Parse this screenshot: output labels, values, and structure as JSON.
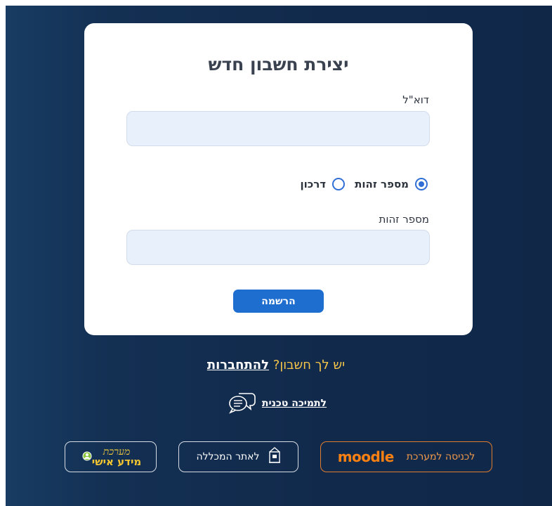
{
  "form": {
    "title": "יצירת חשבון חדש",
    "email_label": "דוא\"ל",
    "email_value": "",
    "id_type_options": [
      {
        "label": "מספר זהות",
        "selected": true
      },
      {
        "label": "דרכון",
        "selected": false
      }
    ],
    "id_label": "מספר זהות",
    "id_value": "",
    "register_label": "הרשמה"
  },
  "login_prompt": {
    "text": "יש לך חשבון?",
    "link": "להתחברות"
  },
  "support": {
    "link": "לתמיכה טכנית",
    "icon": "chat-bubbles-icon"
  },
  "bottom_links": {
    "moodle": {
      "label": "לכניסה למערכת",
      "logo_text": "moodle",
      "icon": "moodle-logo"
    },
    "college": {
      "label": "לאתר המכללה",
      "icon": "college-building-icon"
    },
    "personal": {
      "logo_top": "מערכת",
      "logo_bottom": "מידע אישי",
      "icon": "personal-info-logo"
    }
  },
  "colors": {
    "background": "#112a4c",
    "accent": "#1e6ed0",
    "link_yellow": "#f5c54a",
    "moodle_orange": "#f98012"
  }
}
